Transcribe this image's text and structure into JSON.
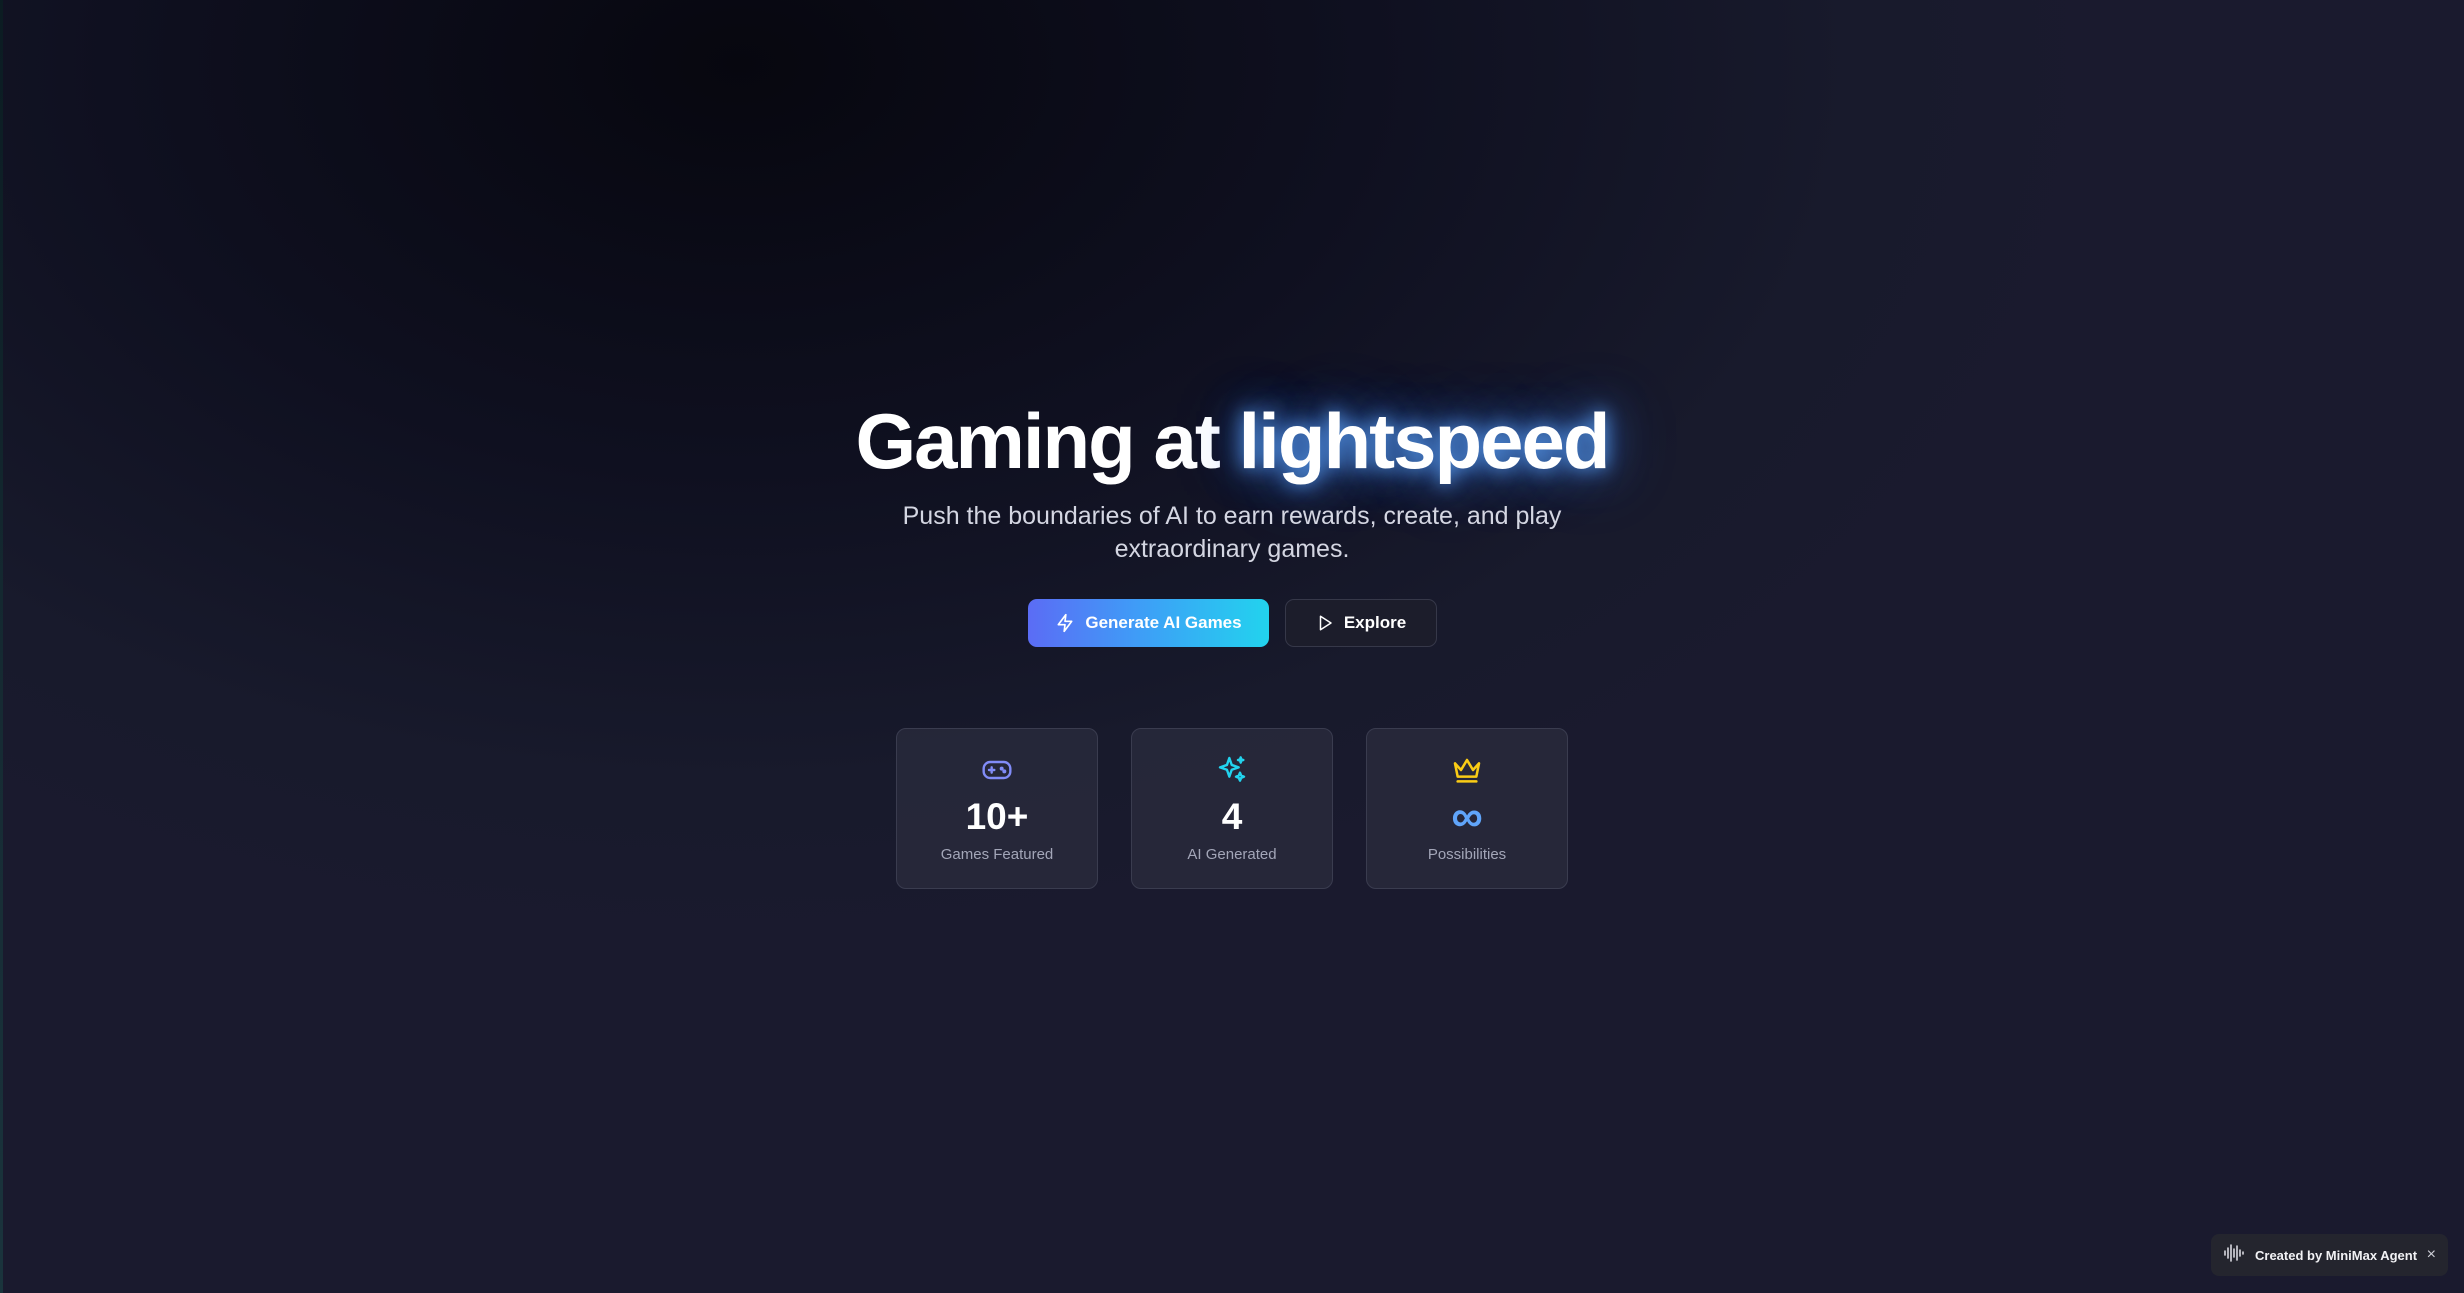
{
  "hero": {
    "title_prefix": "Gaming at ",
    "title_accent": "lightspeed",
    "subtitle": "Push the boundaries of AI to earn rewards, create, and play extraordinary games."
  },
  "actions": {
    "primary_label": "Generate AI Games",
    "secondary_label": "Explore"
  },
  "stats": [
    {
      "icon": "gamepad-icon",
      "value": "10+",
      "label": "Games Featured",
      "icon_color": "#818cf8"
    },
    {
      "icon": "sparkles-icon",
      "value": "4",
      "label": "AI Generated",
      "icon_color": "#22d3ee"
    },
    {
      "icon": "crown-icon",
      "value": "∞",
      "label": "Possibilities",
      "icon_color": "#facc15"
    }
  ],
  "badge": {
    "text": "Created by MiniMax Agent",
    "close": "×"
  },
  "colors": {
    "accent_glow": "#3b82f6",
    "primary_gradient_start": "#5b6cf5",
    "primary_gradient_end": "#22d3ee",
    "infinity": "#60a5fa"
  }
}
